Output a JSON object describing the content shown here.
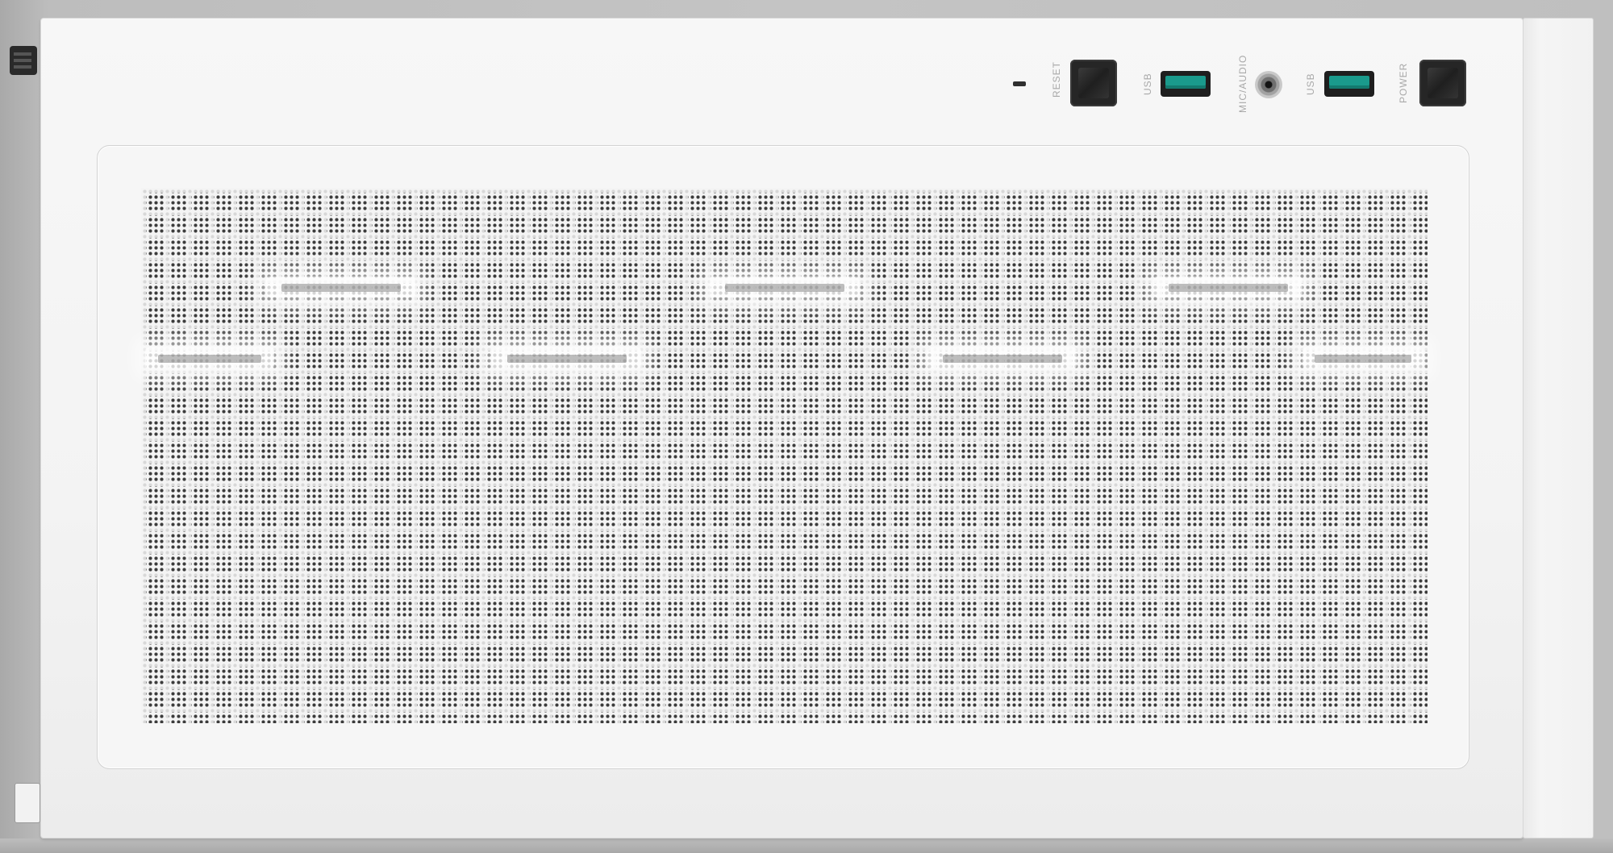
{
  "product": {
    "io_panel": {
      "reset_label": "RESET",
      "usb_left_label": "USB",
      "mic_audio_label": "MIC/AUDIO",
      "usb_right_label": "USB",
      "power_label": "POWER"
    },
    "colors": {
      "case_white": "#f4f4f4",
      "usb_port_teal": "#1a9a8c",
      "button_black": "#262626",
      "backdrop_gray": "#c2c2c2"
    },
    "icons": [
      "reset-button",
      "usb-port",
      "audio-jack",
      "power-button",
      "status-led"
    ]
  }
}
